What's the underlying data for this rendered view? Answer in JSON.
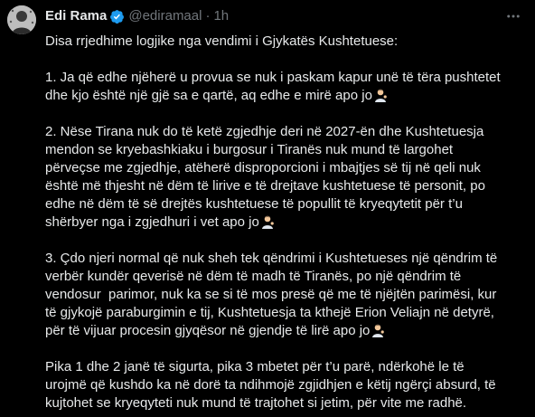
{
  "author": {
    "name": "Edi Rama",
    "handle": "@ediramaal",
    "separator": "·",
    "time": "1h"
  },
  "icons": {
    "verified": "verified-badge-icon",
    "more": "more-options-icon",
    "emoji": "person-tipping-hand-emoji"
  },
  "colors": {
    "background": "#000000",
    "text": "#e7e9ea",
    "muted": "#71767b",
    "verified": "#1d9bf0"
  },
  "tweet": {
    "intro": "Disa rrjedhime logjike nga vendimi i Gjykatës Kushtetuese:",
    "p1": [
      "1. Ja që edhe njëherë u provua se nuk i paskam kapur unë të tëra pushtetet",
      "dhe kjo është një gjë sa e qartë, aq edhe e mirë apo jo"
    ],
    "p2": [
      "2. Nëse Tirana nuk do të ketë zgjedhje deri në 2027-ën dhe Kushtetuesja",
      "mendon se kryebashkiaku i burgosur i Tiranës nuk mund të largohet",
      "përveçse me zgjedhje, atëherë disproporcioni i mbajtjes së tij në qeli nuk",
      "është më thjesht në dëm të lirive e të drejtave kushtetuese të personit, po",
      "edhe në dëm të së drejtës kushtetuese të popullit të kryeqytetit për t’u",
      "shërbyer nga i zgjedhuri i vet apo jo"
    ],
    "p3": [
      "3. Çdo njeri normal që nuk sheh tek qëndrimi i Kushtetueses një qëndrim të",
      "verbër kundër qeverisë në dëm të madh të Tiranës, po një qëndrim të",
      "vendosur  parimor, nuk ka se si të mos presë që me të njëjtën parimësi, kur",
      "të gjykojë paraburgimin e tij, Kushtetuesja ta kthejë Erion Veliajn në detyrë,",
      "për të vijuar procesin gjyqësor në gjendje të lirë apo jo"
    ],
    "p4": [
      "Pika 1 dhe 2 janë të sigurta, pika 3 mbetet për t’u parë, ndërkohë le të",
      "urojmë që kushdo ka në dorë ta ndihmojë zgjidhjen e këtij ngërçi absurd, të",
      "kujtohet se kryeqyteti nuk mund të trajtohet si jetim, për vite me radhë."
    ]
  }
}
